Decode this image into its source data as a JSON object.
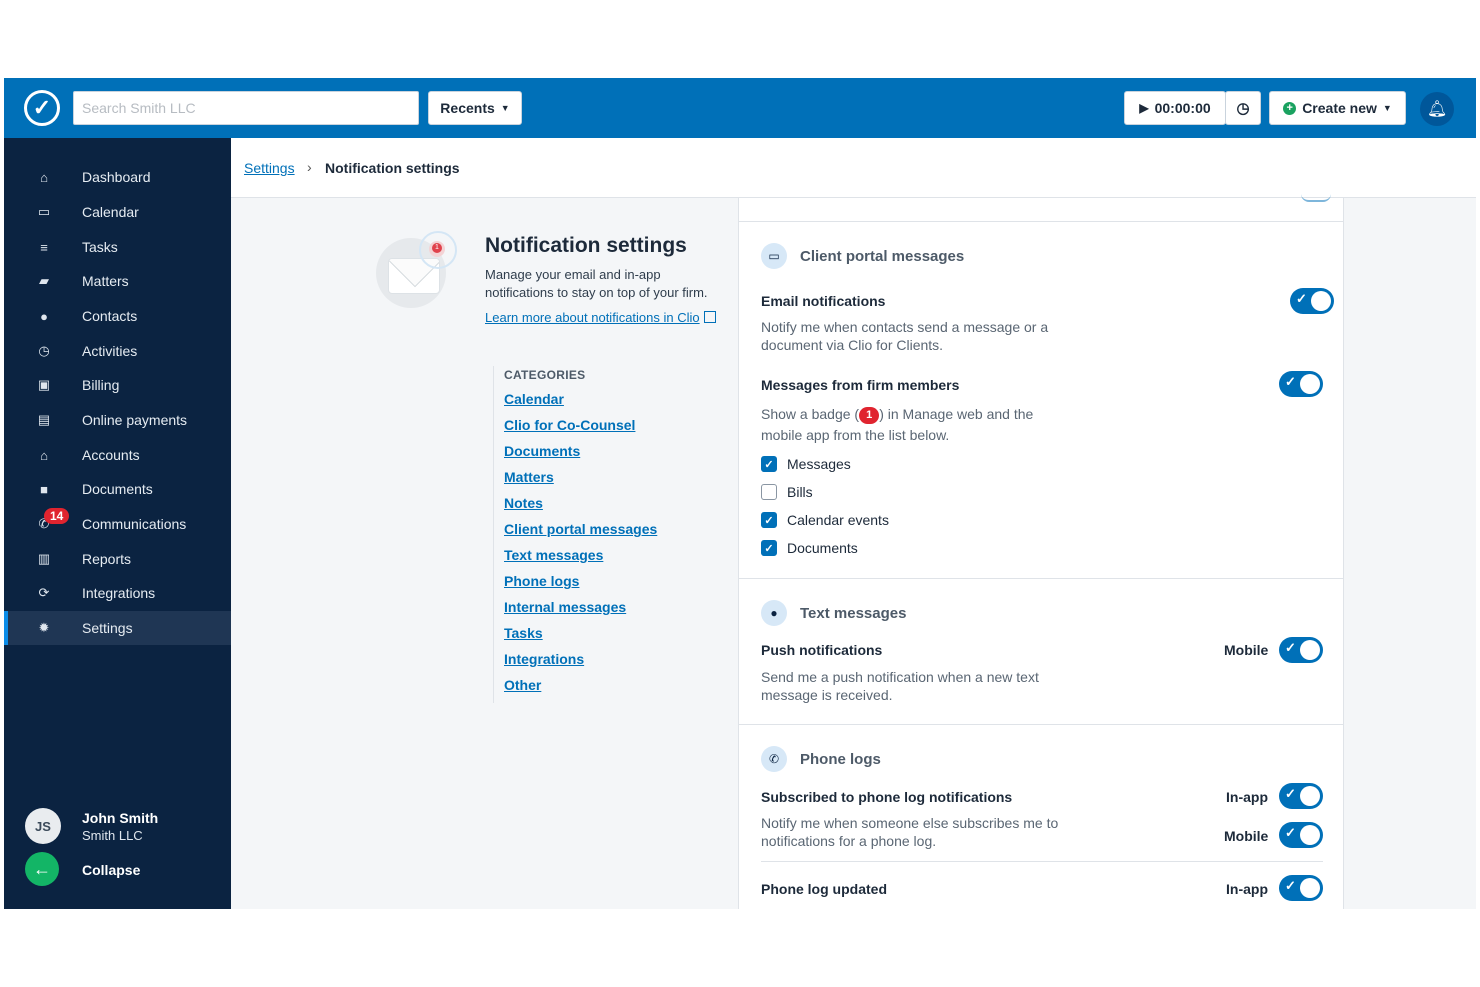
{
  "topbar": {
    "search_placeholder": "Search Smith LLC",
    "recents_label": "Recents",
    "timer_value": "00:00:00",
    "create_label": "Create new"
  },
  "sidebar": {
    "items": [
      {
        "label": "Dashboard",
        "icon": "home-icon"
      },
      {
        "label": "Calendar",
        "icon": "calendar-icon"
      },
      {
        "label": "Tasks",
        "icon": "list-icon"
      },
      {
        "label": "Matters",
        "icon": "briefcase-icon"
      },
      {
        "label": "Contacts",
        "icon": "person-icon"
      },
      {
        "label": "Activities",
        "icon": "clock-icon"
      },
      {
        "label": "Billing",
        "icon": "money-icon"
      },
      {
        "label": "Online payments",
        "icon": "card-icon"
      },
      {
        "label": "Accounts",
        "icon": "bank-icon"
      },
      {
        "label": "Documents",
        "icon": "folder-icon"
      },
      {
        "label": "Communications",
        "icon": "phone-icon",
        "badge": "14"
      },
      {
        "label": "Reports",
        "icon": "chart-icon"
      },
      {
        "label": "Integrations",
        "icon": "sync-icon"
      },
      {
        "label": "Settings",
        "icon": "gear-icon",
        "active": true
      }
    ],
    "user": {
      "initials": "JS",
      "name": "John Smith",
      "firm": "Smith LLC"
    },
    "collapse_label": "Collapse"
  },
  "breadcrumb": {
    "parent": "Settings",
    "current": "Notification settings"
  },
  "intro": {
    "title": "Notification settings",
    "description": "Manage your email and in-app notifications to stay on top of your firm.",
    "learn_link": "Learn more about notifications in Clio"
  },
  "categories": {
    "title": "CATEGORIES",
    "links": [
      "Calendar",
      "Clio for Co-Counsel",
      "Documents",
      "Matters",
      "Notes",
      "Client portal messages",
      "Text messages",
      "Phone logs",
      "Internal messages",
      "Tasks",
      "Integrations",
      "Other"
    ]
  },
  "client_portal": {
    "title": "Client portal messages",
    "email_title": "Email notifications",
    "email_desc": "Notify me when contacts send a message or a document via Clio for Clients.",
    "email_on": true,
    "firm_title": "Messages from firm members",
    "firm_desc_pre": "Show a badge (",
    "firm_badge": "1",
    "firm_desc_post": ") in Manage web and the mobile app from the list below.",
    "firm_on": true,
    "checkboxes": [
      {
        "label": "Messages",
        "checked": true
      },
      {
        "label": "Bills",
        "checked": false
      },
      {
        "label": "Calendar events",
        "checked": true
      },
      {
        "label": "Documents",
        "checked": true
      }
    ]
  },
  "text_messages": {
    "title": "Text messages",
    "push_title": "Push notifications",
    "push_desc": "Send me a push notification when a new text message is received.",
    "push_channel": "Mobile",
    "push_on": true
  },
  "phone_logs": {
    "title": "Phone logs",
    "sub_title": "Subscribed to phone log notifications",
    "sub_desc": "Notify me when someone else subscribes me to notifications for a phone log.",
    "sub_channel_1": "In-app",
    "sub_channel_2": "Mobile",
    "updated_title": "Phone log updated",
    "updated_channel": "In-app"
  },
  "colors": {
    "brand": "#0070b8",
    "sidebar": "#0b2341",
    "badge": "#e0242f",
    "success": "#13b566"
  }
}
